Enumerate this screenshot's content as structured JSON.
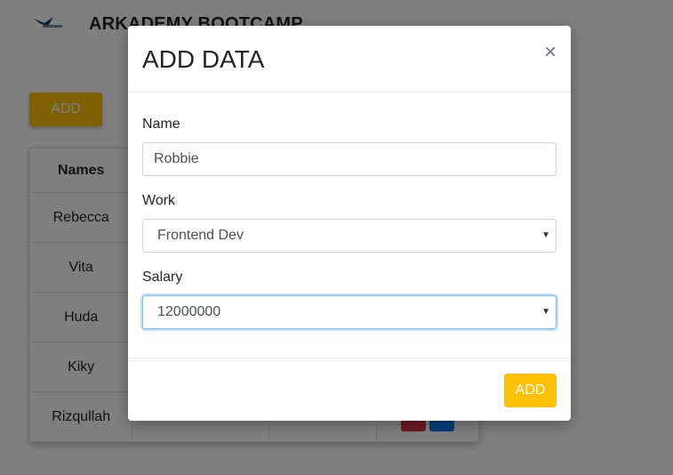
{
  "app": {
    "title": "ARKADEMY BOOTCAMP",
    "add_button_label": "ADD"
  },
  "table": {
    "headers": [
      "Names"
    ],
    "rows": [
      "Rebecca",
      "Vita",
      "Huda",
      "Kiky",
      "Rizqullah"
    ]
  },
  "modal": {
    "title": "ADD DATA",
    "close_symbol": "×",
    "name_label": "Name",
    "name_value": "Robbie",
    "work_label": "Work",
    "work_value": "Frontend Dev",
    "salary_label": "Salary",
    "salary_value": "12000000",
    "submit_label": "ADD"
  },
  "colors": {
    "accent": "#ffc107",
    "danger": "#dc3545",
    "primary": "#007bff"
  }
}
